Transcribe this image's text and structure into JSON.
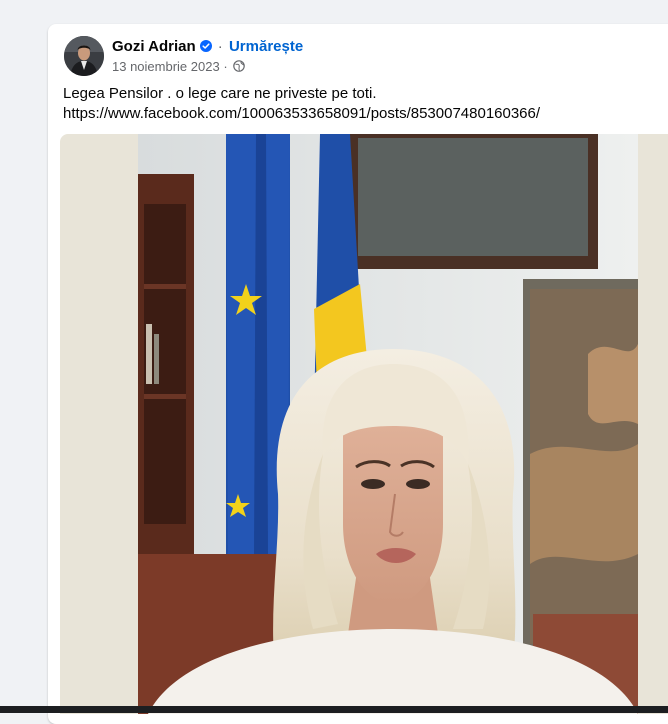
{
  "post": {
    "author": "Gozi Adrian",
    "separator": "·",
    "follow_label": "Urmărește",
    "date": "13 noiembrie 2023",
    "date_separator": "·",
    "text_line1": "Legea Pensilor . o lege care ne priveste pe toti.",
    "text_line2": "https://www.facebook.com/100063533658091/posts/853007480160366/"
  },
  "icons": {
    "verified": "verified-badge-icon",
    "privacy": "globe-icon"
  },
  "colors": {
    "background": "#f0f2f5",
    "card": "#ffffff",
    "link_blue": "#0064d1",
    "verified_blue": "#0866ff",
    "secondary_text": "#65676b"
  }
}
